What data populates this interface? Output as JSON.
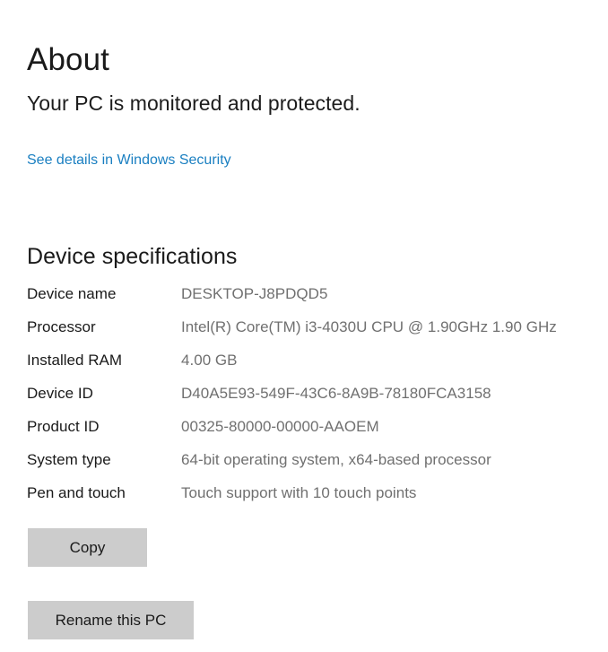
{
  "page": {
    "title": "About",
    "status_text": "Your PC is monitored and protected.",
    "security_link": "See details in Windows Security"
  },
  "device_specifications": {
    "heading": "Device specifications",
    "rows": [
      {
        "label": "Device name",
        "value": "DESKTOP-J8PDQD5"
      },
      {
        "label": "Processor",
        "value": "Intel(R) Core(TM) i3-4030U CPU @ 1.90GHz   1.90 GHz"
      },
      {
        "label": "Installed RAM",
        "value": "4.00 GB"
      },
      {
        "label": "Device ID",
        "value": "D40A5E93-549F-43C6-8A9B-78180FCA3158"
      },
      {
        "label": "Product ID",
        "value": "00325-80000-00000-AAOEM"
      },
      {
        "label": "System type",
        "value": "64-bit operating system, x64-based processor"
      },
      {
        "label": "Pen and touch",
        "value": "Touch support with 10 touch points"
      }
    ]
  },
  "actions": {
    "copy_label": "Copy",
    "rename_label": "Rename this PC"
  },
  "colors": {
    "background": "#ffffff",
    "label_text": "#1a1a1a",
    "value_text": "#707070",
    "link": "#1a7fc1",
    "button_face": "#cccccc"
  }
}
